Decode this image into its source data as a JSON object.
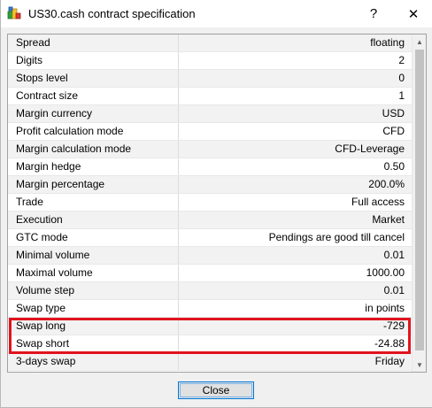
{
  "window": {
    "title": "US30.cash contract specification",
    "help_glyph": "?",
    "close_glyph": "✕"
  },
  "icons": {
    "app": "contract-spec-icon",
    "help": "help-icon",
    "close": "close-icon"
  },
  "colors": {
    "highlight": "#e0141e",
    "button_border": "#0078d7",
    "row_alt": "#f2f2f2"
  },
  "spec": {
    "rows": [
      {
        "label": "Spread",
        "value": "floating"
      },
      {
        "label": "Digits",
        "value": "2"
      },
      {
        "label": "Stops level",
        "value": "0"
      },
      {
        "label": "Contract size",
        "value": "1"
      },
      {
        "label": "Margin currency",
        "value": "USD"
      },
      {
        "label": "Profit calculation mode",
        "value": "CFD"
      },
      {
        "label": "Margin calculation mode",
        "value": "CFD-Leverage"
      },
      {
        "label": "Margin hedge",
        "value": "0.50"
      },
      {
        "label": "Margin percentage",
        "value": "200.0%"
      },
      {
        "label": "Trade",
        "value": "Full access"
      },
      {
        "label": "Execution",
        "value": "Market"
      },
      {
        "label": "GTC mode",
        "value": "Pendings are good till cancel"
      },
      {
        "label": "Minimal volume",
        "value": "0.01"
      },
      {
        "label": "Maximal volume",
        "value": "1000.00"
      },
      {
        "label": "Volume step",
        "value": "0.01"
      },
      {
        "label": "Swap type",
        "value": "in points"
      },
      {
        "label": "Swap long",
        "value": "-729"
      },
      {
        "label": "Swap short",
        "value": "-24.88"
      },
      {
        "label": "3-days swap",
        "value": "Friday"
      }
    ]
  },
  "footer": {
    "close_label": "Close"
  }
}
